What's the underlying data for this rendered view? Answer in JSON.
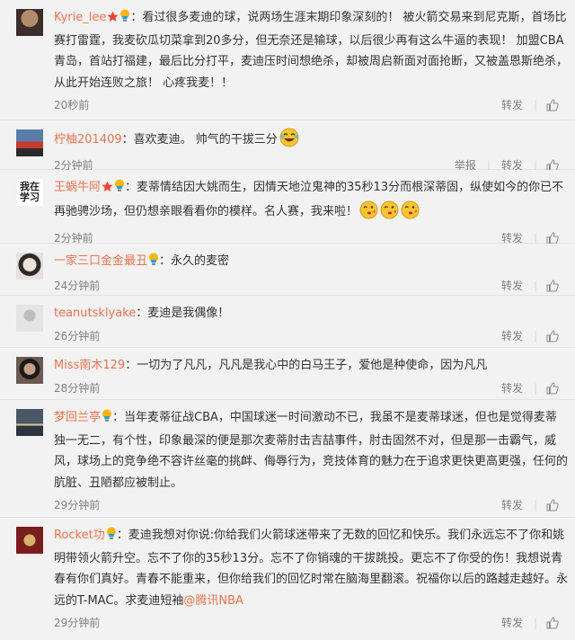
{
  "actions": {
    "repost": "转发",
    "report": "举报",
    "like_icon": "thumbs-up-icon"
  },
  "comments": [
    {
      "user": "Kyrie_lee",
      "badges": [
        "star",
        "lightbulb"
      ],
      "text": "：看过很多麦迪的球，说两场生涯末期印象深刻的！ 被火箭交易来到尼克斯，首场比赛打雷霆，我麦砍瓜切菜拿到20多分，但无奈还是输球，以后很少再有这么牛逼的表现！ 加盟CBA青岛，首站打福建，最后比分打平，麦迪压时间想绝杀，却被周启新面对面抢断，又被盖恩斯绝杀，从此开始连败之旅！ 心疼我麦！！",
      "time": "20秒前",
      "avatar_colors": [
        "#3b2e2a",
        "#b58b6e"
      ]
    },
    {
      "user": "柠柚201409",
      "badges": [],
      "text": "：喜欢麦迪。 帅气的干拔三分",
      "emojis": [
        "laugh-cry"
      ],
      "time": "2分钟前",
      "show_report": true,
      "avatar_colors": [
        "#c43b2e",
        "#5a7da8"
      ]
    },
    {
      "user": "王蜗牛阿",
      "badges": [
        "star",
        "lightbulb"
      ],
      "text": "：麦蒂情结因大姚而生，因情天地泣鬼神的35秒13分而根深蒂固，纵使如今的你已不再驰骋沙场，但仍想亲眼看看你的模样。名人赛，我来啦！",
      "emojis": [
        "kiss",
        "kiss",
        "kiss"
      ],
      "time": "2分钟前",
      "avatar_text": "我在\n学习",
      "avatar_colors": [
        "#ffffff",
        "#222222"
      ]
    },
    {
      "user": "一家三口金金最丑",
      "badges": [
        "lightbulb"
      ],
      "text": "：永久的麦密",
      "time": "24分钟前",
      "avatar_colors": [
        "#f1e2d8",
        "#2a2a2a"
      ]
    },
    {
      "user": "teanutsklyake",
      "badges": [],
      "text": "：麦迪是我偶像！",
      "time": "26分钟前",
      "avatar_colors": [
        "#e4e4e4",
        "#bdbdbd"
      ]
    },
    {
      "user": "Miss南木129",
      "badges": [],
      "text": "：一切为了凡凡，凡凡是我心中的白马王子，爱他是种使命，因为凡凡",
      "time": "28分钟前",
      "avatar_colors": [
        "#6c5a52",
        "#1e1a1a"
      ]
    },
    {
      "user": "梦回兰亭",
      "badges": [
        "lightbulb"
      ],
      "text": "：当年麦蒂征战CBA，中国球迷一时间激动不已，我虽不是麦蒂球迷，但也是觉得麦蒂独一无二，有个性，印象最深的便是那次麦蒂肘击吉喆事件，肘击固然不对，但是那一击霸气，威风，球场上的竞争绝不容许丝毫的挑衅、侮辱行为，竞技体育的魅力在于追求更快更高更强，任何的肮脏、丑陋都应被制止。",
      "time": "29分钟前",
      "avatar_colors": [
        "#4a5866",
        "#d9c39a"
      ]
    },
    {
      "user": "Rocket功",
      "badges": [
        "lightbulb"
      ],
      "text": "：麦迪我想对你说:你给我们火箭球迷带来了无数的回忆和快乐。我们永远忘不了你和姚明带领火箭升空。忘不了你的35秒13分。忘不了你销魂的干拔跳投。更忘不了你受的伤！我想说青春有你们真好。青春不能重来，但你给我们的回忆时常在脑海里翻滚。祝福你以后的路越走越好。永远的T-MAC。求麦迪短袖",
      "link": "@腾讯NBA",
      "time": "29分钟前",
      "avatar_colors": [
        "#7a1d1d",
        "#d8b36a"
      ]
    }
  ]
}
